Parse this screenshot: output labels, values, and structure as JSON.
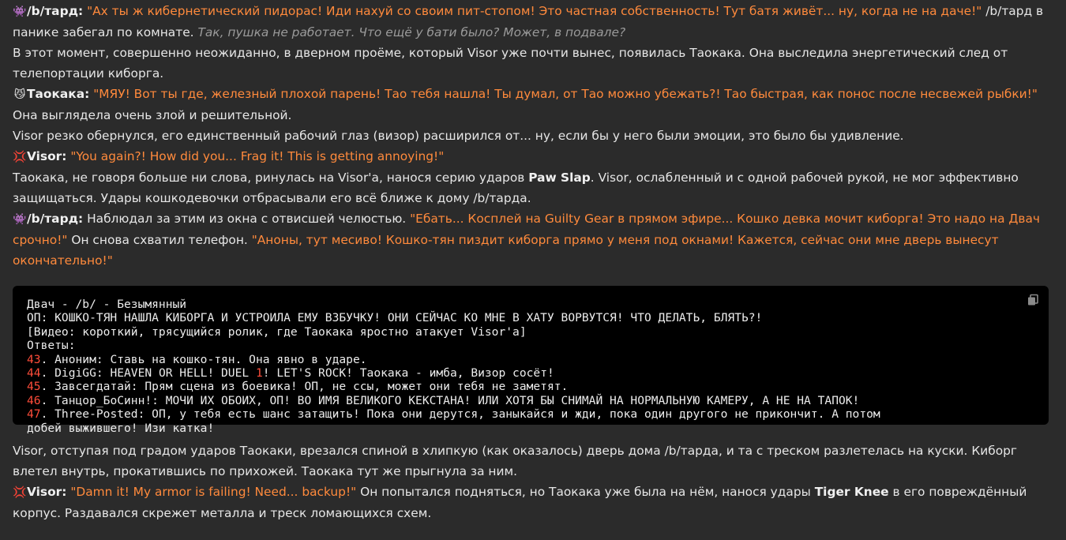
{
  "messages": {
    "p1": {
      "emoji": "👾",
      "speaker": "/b/тард:",
      "quote": "\"Ах ты ж кибернетический пидорас! Иди нахуй со своим пит-стопом! Это частная собственность! Тут батя живёт... ну, когда не на даче!\"",
      "text": " /b/тард в панике забегал по комнате.",
      "thought": "Так, пушка не работает. Что ещё у бати было? Может, в подвале?"
    },
    "p2": {
      "text": "В этот момент, совершенно неожиданно, в дверном проёме, который Visor уже почти вынес, появилась Таокака. Она выследила энергетический след от телепортации киборга."
    },
    "p3": {
      "emoji": "😼",
      "speaker": "Таокака:",
      "quote": "\"МЯУ! Вот ты где, железный плохой парень! Тао тебя нашла! Ты думал, от Тао можно убежать?! Тао быстрая, как понос после несвежей рыбки!\"",
      "text": " Она выглядела очень злой и решительной."
    },
    "p4": {
      "text": "Visor резко обернулся, его единственный рабочий глаз (визор) расширился от... ну, если бы у него были эмоции, это было бы удивление."
    },
    "p5": {
      "emoji": "💢",
      "speaker": "Visor:",
      "quote": "\"You again?! How did you... Frag it! This is getting annoying!\""
    },
    "p6": {
      "text_a": "Таокака, не говоря больше ни слова, ринулась на Visor'а, нанося серию ударов ",
      "bold": "Paw Slap",
      "text_b": ". Visor, ослабленный и с одной рабочей рукой, не мог эффективно защищаться. Удары кошкодевочки отбрасывали его всё ближе к дому /b/тарда."
    },
    "p7": {
      "emoji": "👾",
      "speaker": "/b/тард:",
      "text_a": " Наблюдал за этим из окна с отвисшей челюстью. ",
      "quote_a": "\"Ебать... Косплей на Guilty Gear в прямом эфире... Кошко девка мочит киборга! Это надо на Двач срочно!\"",
      "text_b": " Он снова схватил телефон. ",
      "quote_b": "\"Аноны, тут месиво! Кошко-тян пиздит киборга прямо у меня под окнами! Кажется, сейчас они мне дверь вынесут окончательно!\""
    },
    "p8": {
      "text": "Visor, отступая под градом ударов Таокаки, врезался спиной в хлипкую (как оказалось) дверь дома /b/тарда, и та с треском разлетелась на куски. Киборг влетел внутрь, прокатившись по прихожей. Таокака тут же прыгнула за ним."
    },
    "p9": {
      "emoji": "💢",
      "speaker": "Visor:",
      "quote": "\"Damn it! My armor is failing! Need... backup!\"",
      "text_a": " Он попытался подняться, но Таокака уже была на нём, нанося удары ",
      "bold": "Tiger Knee",
      "text_b": " в его повреждённый корпус. Раздавался скрежет металла и треск ломающихся схем."
    }
  },
  "code_block": {
    "title": "Двач - /b/ - Безымянный",
    "op": "ОП: КОШКО-ТЯН НАШЛА КИБОРГА И УСТРОИЛА ЕМУ ВЗБУЧКУ! ОНИ СЕЙЧАС КО МНЕ В ХАТУ ВОРВУТСЯ! ЧТО ДЕЛАТЬ, БЛЯТЬ?!",
    "video": "[Видео: короткий, трясущийся ролик, где Таокака яростно атакует Visor'а]",
    "answers_label": "Ответы:",
    "replies": [
      {
        "num": "43",
        "text": ". Аноним: Ставь на кошко-тян. Она явно в ударе."
      },
      {
        "num": "44",
        "text_a": ". DigiGG: HEAVEN OR HELL! DUEL ",
        "num2": "1",
        "text_b": "! LET'S ROCK! Таокака - имба, Визор сосёт!"
      },
      {
        "num": "45",
        "text": ". Завсегдатай: Прям сцена из боевика! ОП, не ссы, может они тебя не заметят."
      },
      {
        "num": "46",
        "text": ". Танцор_БоСинн!: МОЧИ ИХ ОБОИХ, ОП! ВО ИМЯ ВЕЛИКОГО КЕКСТАНА! ИЛИ ХОТЯ БЫ СНИМАЙ НА НОРМАЛЬНУЮ КАМЕРУ, А НЕ НА ТАПОК!"
      },
      {
        "num": "47",
        "text": ". Three-Posted: ОП, у тебя есть шанс затащить! Пока они дерутся, заныкайся и жди, пока один другого не прикончит. А потом"
      },
      {
        "text": "добей выжившего! Изи катка!"
      }
    ],
    "copy_icon": "copy-icon"
  },
  "colors": {
    "background": "#2b2b2b",
    "text": "#e6e6e6",
    "quote": "#ff8a3c",
    "thought": "#9a9a9a",
    "code_bg": "#000000",
    "code_number": "#ff4d3a"
  }
}
